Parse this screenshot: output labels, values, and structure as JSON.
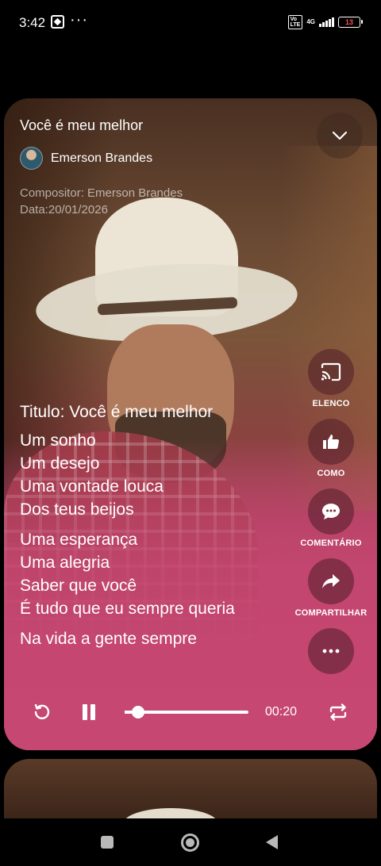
{
  "status_bar": {
    "time": "3:42",
    "dots": "···",
    "volte": "Vo LTE",
    "network": "4G",
    "battery": "13"
  },
  "song": {
    "title": "Você é meu melhor",
    "author": "Emerson Brandes",
    "composer": "Compositor: Emerson Brandes",
    "date": "Data:20/01/2026"
  },
  "lyrics": {
    "title": "Titulo: Você é meu melhor",
    "stanzas": [
      "Um sonho\nUm desejo\nUma vontade louca\nDos teus beijos",
      "Uma esperança\nUma alegria\nSaber que você\nÉ tudo que eu sempre queria",
      "Na vida a gente sempre"
    ]
  },
  "actions": [
    {
      "label": "ELENCO",
      "icon": "cast-icon"
    },
    {
      "label": "COMO",
      "icon": "thumbs-up-icon"
    },
    {
      "label": "COMENTÁRIO",
      "icon": "comment-icon"
    },
    {
      "label": "COMPARTILHAR",
      "icon": "share-icon"
    },
    {
      "label": "",
      "icon": "more-icon"
    }
  ],
  "player": {
    "current_time": "00:20",
    "progress_fraction": 0.11,
    "state": "playing"
  },
  "colors": {
    "card_pink": "#c44671",
    "nav_gray": "#b9b9b9"
  }
}
